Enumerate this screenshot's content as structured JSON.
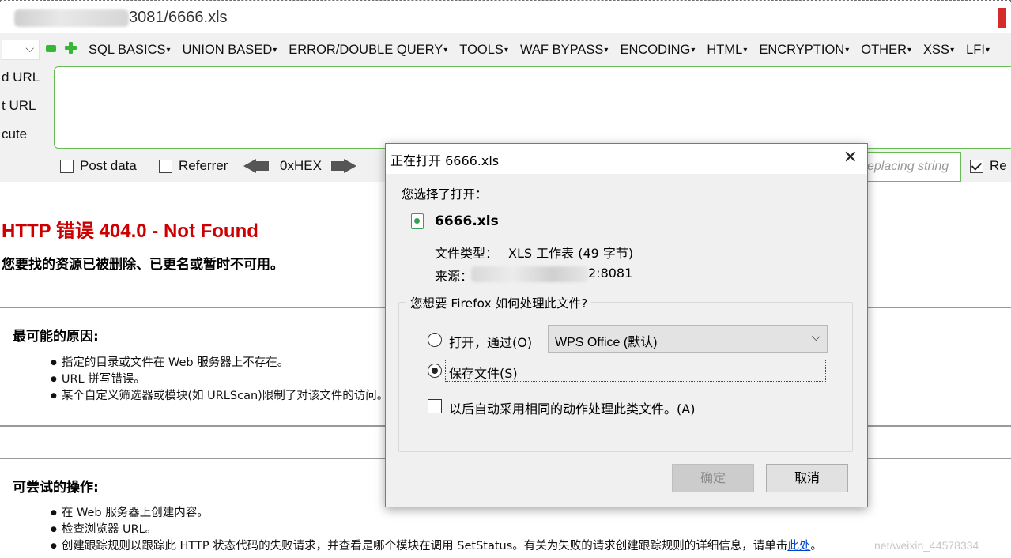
{
  "browser": {
    "url_tail": "3081/6666.xls"
  },
  "hackbar": {
    "menu": [
      "SQL BASICS",
      "UNION BASED",
      "ERROR/DOUBLE QUERY",
      "TOOLS",
      "WAF BYPASS",
      "ENCODING",
      "HTML",
      "ENCRYPTION",
      "OTHER",
      "XSS",
      "LFI"
    ],
    "side_labels": [
      "d URL",
      "t URL",
      "cute"
    ],
    "options": {
      "post_data": "Post data",
      "referrer": "Referrer",
      "hex": "0xHEX",
      "replacing_string": "eplacing string",
      "re": "Re"
    }
  },
  "error_page": {
    "title": "HTTP 错误 404.0 - Not Found",
    "subtitle": "您要找的资源已被删除、已更名或暂时不可用。",
    "causes_title": "最可能的原因:",
    "causes": [
      "指定的目录或文件在 Web 服务器上不存在。",
      "URL 拼写错误。",
      "某个自定义筛选器或模块(如 URLScan)限制了对该文件的访问。"
    ],
    "actions_title": "可尝试的操作:",
    "actions": [
      "在 Web 服务器上创建内容。",
      "检查浏览器 URL。"
    ],
    "action_last_prefix": "创建跟踪规则以跟踪此 HTTP 状态代码的失败请求，并查看是哪个模块在调用 SetStatus。有关为失败的请求创建跟踪规则的详细信息，请单击",
    "action_last_link": "此处",
    "action_last_suffix": "。",
    "watermark": "net/weixin_44578334"
  },
  "dialog": {
    "title": "正在打开 6666.xls",
    "chosen_label": "您选择了打开：",
    "file_name": "6666.xls",
    "type_label": "文件类型：",
    "type_value": "XLS 工作表 (49 字节)",
    "source_label": "来源：",
    "source_tail": "2:8081",
    "question": "您想要 Firefox 如何处理此文件?",
    "open_with_label": "打开，通过(O)",
    "open_with_app": "WPS Office (默认)",
    "save_file_label": "保存文件(S)",
    "auto_label": "以后自动采用相同的动作处理此类文件。(A)",
    "ok_button": "确定",
    "cancel_button": "取消",
    "selected_option": "save",
    "colors": {
      "title_red": "#cc0000",
      "link_blue": "#0044cc",
      "hackbar_green": "#35b935"
    }
  }
}
